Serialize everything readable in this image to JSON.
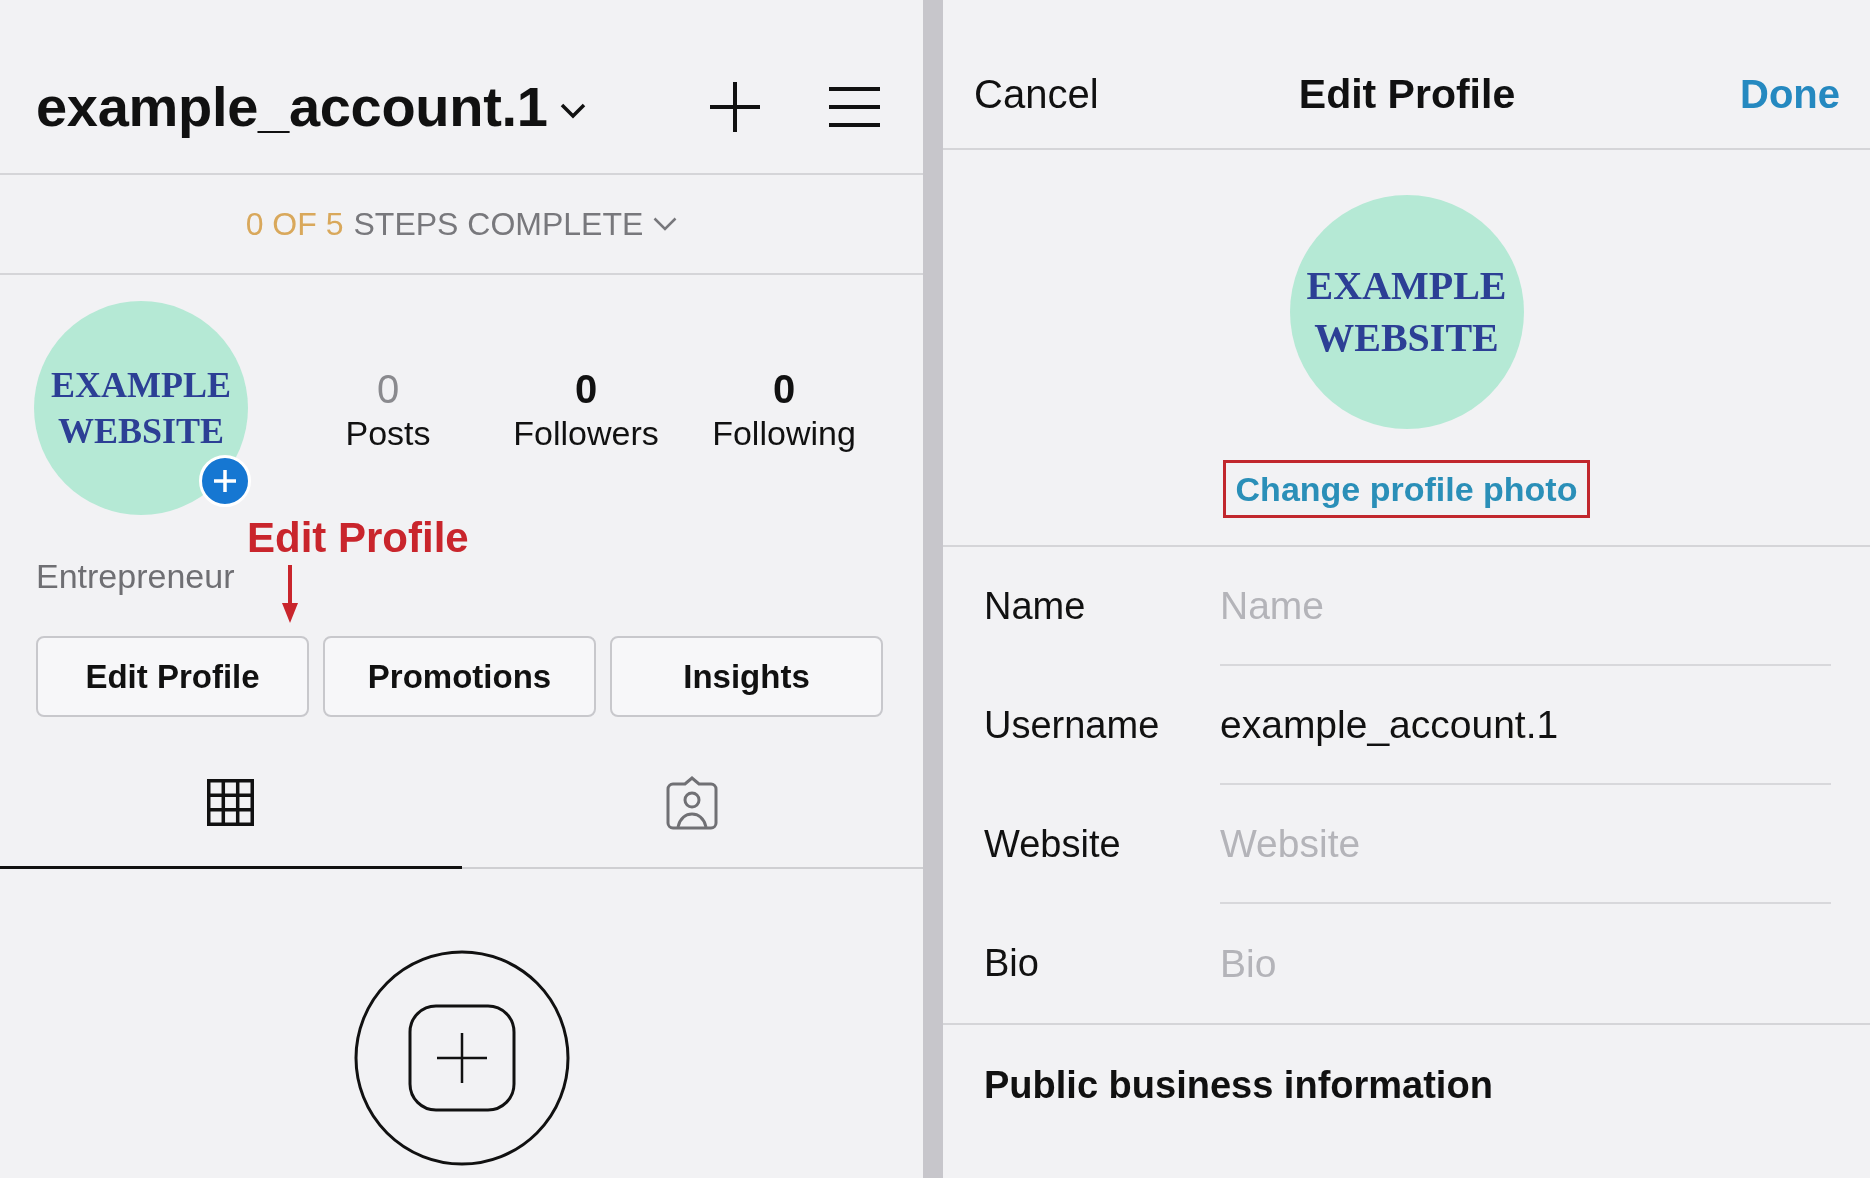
{
  "profile_screen": {
    "header": {
      "username": "example_account.1"
    },
    "setup": {
      "progress": "0 OF 5",
      "label": "STEPS COMPLETE"
    },
    "avatar": {
      "logo_text": "EXAMPLE WEBSITE"
    },
    "stats": [
      {
        "count": "0",
        "label": "Posts",
        "dimmed": true
      },
      {
        "count": "0",
        "label": "Followers",
        "dimmed": false
      },
      {
        "count": "0",
        "label": "Following",
        "dimmed": false
      }
    ],
    "category": "Entrepreneur",
    "annotation": {
      "text": "Edit Profile"
    },
    "buttons": [
      "Edit Profile",
      "Promotions",
      "Insights"
    ],
    "tabs": [
      {
        "kind": "grid",
        "selected": true
      },
      {
        "kind": "tagged",
        "selected": false
      }
    ]
  },
  "edit_screen": {
    "header": {
      "cancel": "Cancel",
      "title": "Edit Profile",
      "done": "Done"
    },
    "avatar": {
      "logo_text": "EXAMPLE WEBSITE"
    },
    "change_photo": {
      "text": "Change profile photo",
      "highlighted": true
    },
    "fields": [
      {
        "label": "Name",
        "placeholder": "Name"
      },
      {
        "label": "Username",
        "value": "example_account.1"
      },
      {
        "label": "Website",
        "placeholder": "Website"
      },
      {
        "label": "Bio",
        "placeholder": "Bio"
      }
    ],
    "section_title": "Public business information"
  }
}
